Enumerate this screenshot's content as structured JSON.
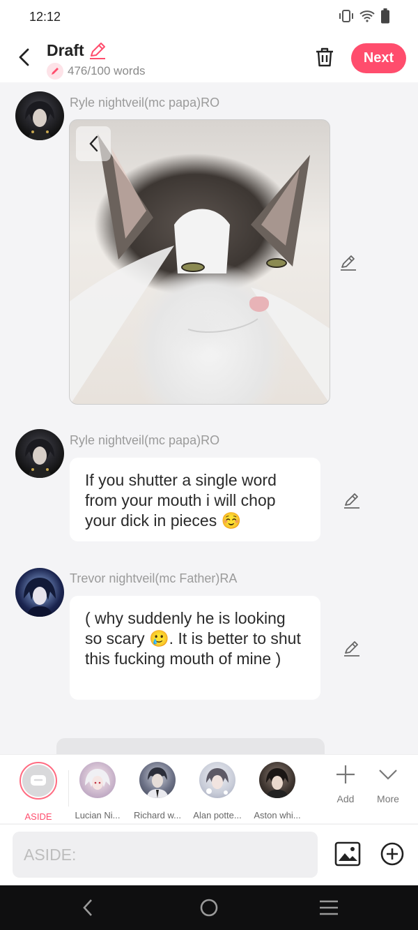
{
  "status_bar": {
    "time": "12:12"
  },
  "header": {
    "title": "Draft",
    "word_count": "476/100 words",
    "next_label": "Next"
  },
  "messages": [
    {
      "sender": "Ryle nightveil(mc papa)RO",
      "type": "image",
      "image_desc_icon": "cat-photo"
    },
    {
      "sender": "Ryle nightveil(mc papa)RO",
      "type": "text",
      "text": "If you shutter a single word from your mouth i will chop your dick in pieces ☺️"
    },
    {
      "sender": "Trevor nightveil(mc Father)RA",
      "type": "text",
      "text": "( why suddenly he is looking so scary 🥲. It is better to shut this fucking mouth of mine )"
    }
  ],
  "characters": [
    {
      "name": "ASIDE",
      "selected": true
    },
    {
      "name": "Lucian Ni..."
    },
    {
      "name": "Richard w..."
    },
    {
      "name": "Alan potte..."
    },
    {
      "name": "Aston whi..."
    }
  ],
  "bar_actions": {
    "add": "Add",
    "more": "More"
  },
  "composer": {
    "placeholder": "ASIDE:"
  },
  "colors": {
    "accent": "#ff4d6d",
    "background": "#f4f4f6"
  }
}
